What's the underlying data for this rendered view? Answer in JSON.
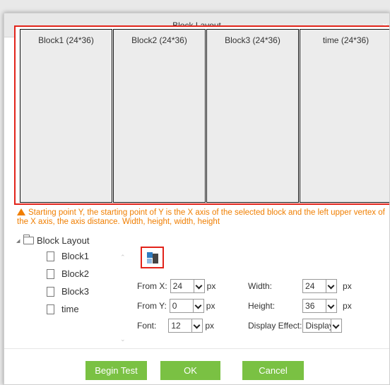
{
  "dialog": {
    "title": "Block Layout",
    "close_label": "×"
  },
  "preview": {
    "blocks": [
      {
        "label": "Block1 (24*36)"
      },
      {
        "label": "Block2 (24*36)"
      },
      {
        "label": "Block3 (24*36)"
      },
      {
        "label": "time (24*36)"
      }
    ]
  },
  "warning": {
    "text": "Starting point Y, the starting point of Y is the X axis of the selected block and the left upper vertex of the X axis, the axis distance. Width, height, width, height"
  },
  "tree": {
    "root": "Block Layout",
    "items": [
      "Block1",
      "Block2",
      "Block3",
      "time"
    ],
    "selected": "Block2"
  },
  "form": {
    "from_x_label": "From X:",
    "from_x_value": "24",
    "from_y_label": "From Y:",
    "from_y_value": "0",
    "font_label": "Font:",
    "font_value": "12",
    "width_label": "Width:",
    "width_value": "24",
    "height_label": "Height:",
    "height_value": "36",
    "display_label": "Display Effect:",
    "display_value": "Display Ir",
    "unit": "px"
  },
  "buttons": {
    "begin_test": "Begin Test",
    "ok": "OK",
    "cancel": "Cancel"
  },
  "colors": {
    "accent_green": "#7ac143",
    "highlight_red": "#e2231a",
    "warning_orange": "#f07e00"
  }
}
